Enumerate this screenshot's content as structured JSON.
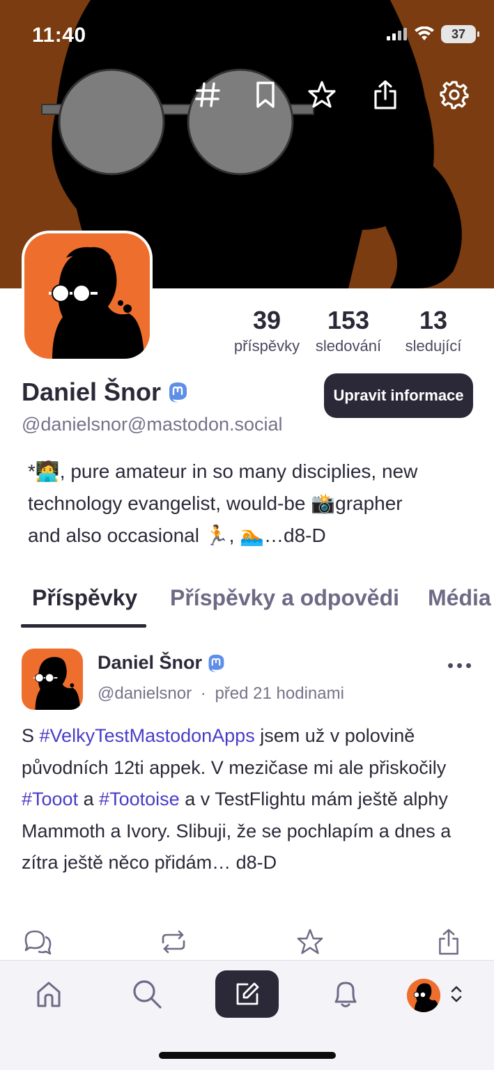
{
  "status_bar": {
    "time": "11:40",
    "battery": "37",
    "icons": [
      "signal-icon",
      "wifi-icon",
      "battery-icon"
    ]
  },
  "header_actions": [
    "hashtag-icon",
    "bookmark-icon",
    "star-icon",
    "share-icon",
    "gear-icon"
  ],
  "profile": {
    "display_name": "Daniel Šnor",
    "handle": "@danielsnor@mastodon.social",
    "edit_button": "Upravit informace",
    "stats": [
      {
        "value": "39",
        "label": "příspěvky"
      },
      {
        "value": "153",
        "label": "sledování"
      },
      {
        "value": "13",
        "label": "sledující"
      }
    ],
    "bio_line1": "*🧑‍💻, pure amateur in so many disciplies, new",
    "bio_line2": "technology evangelist, would-be 📸grapher",
    "bio_line3": "and also occasional 🏃, 🏊…d8-D"
  },
  "tabs": [
    {
      "label": "Příspěvky",
      "active": true
    },
    {
      "label": "Příspěvky a odpovědi",
      "active": false
    },
    {
      "label": "Média",
      "active": false
    }
  ],
  "post": {
    "author": "Daniel Šnor",
    "handle": "@danielsnor",
    "separator": "·",
    "time": "před 21 hodinami",
    "text_part1": "S ",
    "tag1": "#VelkyTestMastodonApps",
    "text_part2": " jsem už v polovině původních 12ti appek. V mezičase mi ale přiskočily ",
    "tag2": "#Tooot",
    "text_part3": " a ",
    "tag3": "#Tootoise",
    "text_part4": " a v TestFlightu mám ještě alphy Mammoth a Ivory. Slibuji, že se pochlapím a dnes a zítra ještě něco přidám… d8-D",
    "actions": [
      "reply-icon",
      "boost-icon",
      "favourite-icon",
      "share-icon"
    ]
  },
  "tabbar": [
    "home-icon",
    "search-icon",
    "compose-icon",
    "bell-icon",
    "account-avatar",
    "chevron-updown-icon"
  ],
  "colors": {
    "banner_bg": "#7a3c10",
    "avatar_bg": "#ee6f2d",
    "primary_dark": "#2b2838",
    "hashtag": "#4a3bc7",
    "mastodon_badge": "#5f8ee8"
  }
}
